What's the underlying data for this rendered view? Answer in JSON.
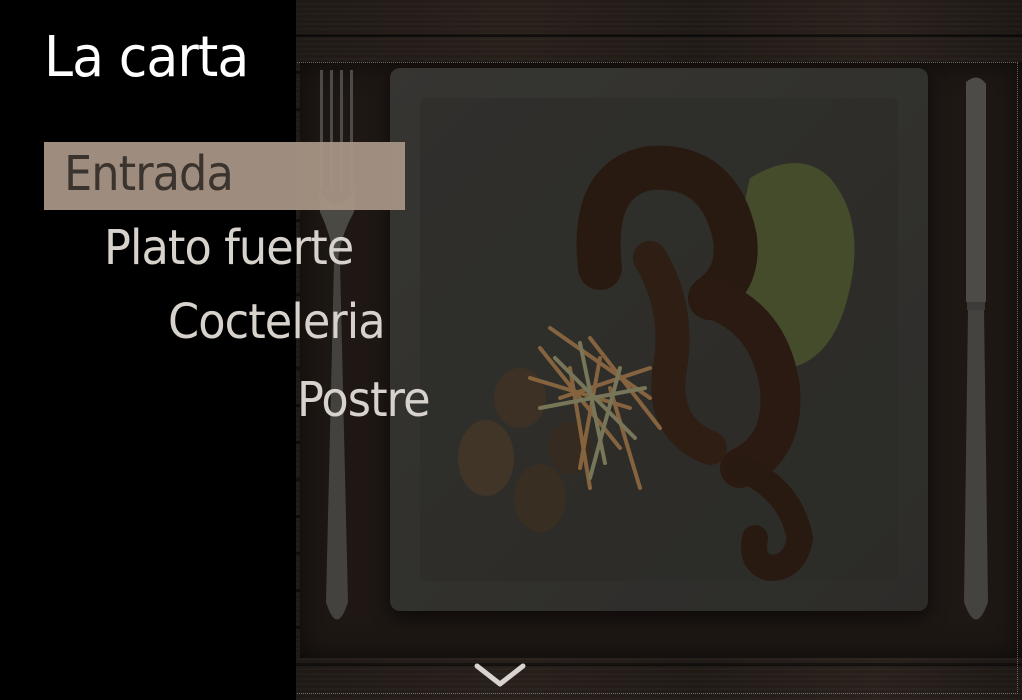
{
  "header": {
    "title": "La carta"
  },
  "menu": {
    "items": [
      {
        "label": "Entrada",
        "active": true
      },
      {
        "label": "Plato fuerte",
        "active": false
      },
      {
        "label": "Cocteleria",
        "active": false
      },
      {
        "label": "Postre",
        "active": false
      }
    ]
  },
  "colors": {
    "active_highlight": "#a79585",
    "menu_text": "#d7d2cc",
    "active_text": "#3b332d",
    "title_text": "#ffffff"
  },
  "icons": {
    "scroll_down": "chevron-down-icon"
  }
}
